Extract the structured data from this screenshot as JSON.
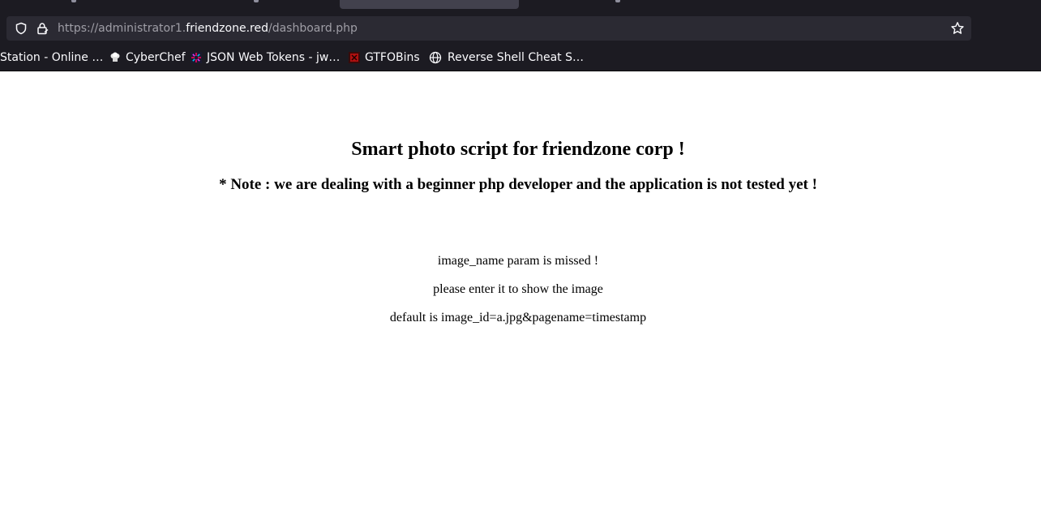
{
  "browser": {
    "url": {
      "scheme": "https://administrator1.",
      "domain": "friendzone.red",
      "path": "/dashboard.php"
    },
    "bookmarks": [
      {
        "label": "Station - Online …",
        "icon": "none"
      },
      {
        "label": "CyberChef",
        "icon": "chef-hat-icon"
      },
      {
        "label": "JSON Web Tokens - jw…",
        "icon": "jwt-icon"
      },
      {
        "label": "GTFOBins",
        "icon": "gtfobins-icon"
      },
      {
        "label": "Reverse Shell Cheat S…",
        "icon": "globe-icon"
      }
    ],
    "colors": {
      "chrome_bg": "#1c1b22",
      "urlbar_bg": "#2b2a33",
      "active_tab": "#42414d"
    }
  },
  "page": {
    "title": "Smart photo script for friendzone corp !",
    "note": "* Note : we are dealing with a beginner php developer and the application is not tested yet !",
    "messages": [
      "image_name param is missed !",
      "please enter it to show the image",
      "default is image_id=a.jpg&pagename=timestamp"
    ]
  }
}
